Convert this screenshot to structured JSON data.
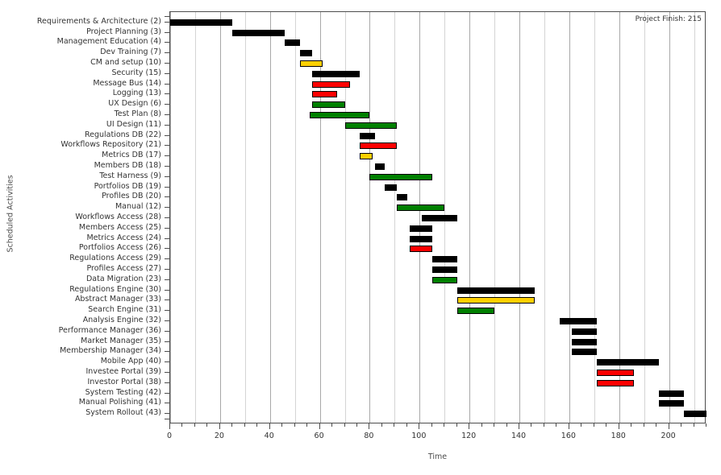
{
  "chart_data": {
    "type": "bar",
    "subtype": "gantt",
    "title": "",
    "xlabel": "Time",
    "ylabel": "Scheduled Activities",
    "xlim": [
      0,
      215
    ],
    "ylim": [
      0,
      43
    ],
    "grid": true,
    "grid_minor_step": 10,
    "grid_major_step": 20,
    "xticks_major": [
      0,
      20,
      40,
      60,
      80,
      100,
      120,
      140,
      160,
      180,
      200
    ],
    "xticks_minor_step": 5,
    "xtick_labels": [
      "0",
      "20",
      "40",
      "60",
      "80",
      "100",
      "120",
      "140",
      "160",
      "180",
      "200"
    ],
    "legend": null,
    "annotations": [
      {
        "name": "project-finish",
        "text": "Project Finish: 215",
        "position": "top-right"
      }
    ],
    "colors": {
      "black": "#000000",
      "red": "#ff0000",
      "green": "#008000",
      "gold": "#ffd000",
      "border": "#000000",
      "gridline_minor": "#d4d4d4",
      "gridline_major": "#a8a8a8",
      "axis": "#4d4d4d",
      "background": "#ffffff"
    },
    "categories": [
      "Requirements & Architecture (2)",
      "Project Planning (3)",
      "Management Education (4)",
      "Dev Training (7)",
      "CM and setup (10)",
      "Security (15)",
      "Message Bus (14)",
      "Logging (13)",
      "UX Design (6)",
      "Test Plan (8)",
      "UI Design (11)",
      "Regulations DB (22)",
      "Workflows Repository (21)",
      "Metrics DB (17)",
      "Members DB (18)",
      "Test Harness (9)",
      "Portfolios DB (19)",
      "Profiles DB (20)",
      "Manual (12)",
      "Workflows Access (28)",
      "Members Access (25)",
      "Metrics Access (24)",
      "Portfolios Access (26)",
      "Regulations Access (29)",
      "Profiles Access (27)",
      "Data Migration (23)",
      "Regulations Engine (30)",
      "Abstract Manager (33)",
      "Search Engine (31)",
      "Analysis Engine (32)",
      "Performance Manager (36)",
      "Market Manager (35)",
      "Membership Manager (34)",
      "Mobile App (40)",
      "Investee Portal (39)",
      "Investor Portal (38)",
      "System Testing (42)",
      "Manual Polishing (41)",
      "System Rollout (43)"
    ],
    "tasks": [
      {
        "label": "Requirements & Architecture (2)",
        "id": 2,
        "start": 0,
        "end": 25,
        "duration": 25,
        "color": "black"
      },
      {
        "label": "Project Planning (3)",
        "id": 3,
        "start": 25,
        "end": 46,
        "duration": 21,
        "color": "black"
      },
      {
        "label": "Management Education (4)",
        "id": 4,
        "start": 46,
        "end": 52,
        "duration": 6,
        "color": "black"
      },
      {
        "label": "Dev Training (7)",
        "id": 7,
        "start": 52,
        "end": 57,
        "duration": 5,
        "color": "black"
      },
      {
        "label": "CM and setup (10)",
        "id": 10,
        "start": 52,
        "end": 61,
        "duration": 9,
        "color": "gold"
      },
      {
        "label": "Security (15)",
        "id": 15,
        "start": 57,
        "end": 76,
        "duration": 19,
        "color": "black"
      },
      {
        "label": "Message Bus (14)",
        "id": 14,
        "start": 57,
        "end": 72,
        "duration": 15,
        "color": "red"
      },
      {
        "label": "Logging (13)",
        "id": 13,
        "start": 57,
        "end": 67,
        "duration": 10,
        "color": "red"
      },
      {
        "label": "UX Design (6)",
        "id": 6,
        "start": 57,
        "end": 70,
        "duration": 13,
        "color": "green"
      },
      {
        "label": "Test Plan (8)",
        "id": 8,
        "start": 56,
        "end": 80,
        "duration": 24,
        "color": "green"
      },
      {
        "label": "UI Design (11)",
        "id": 11,
        "start": 70,
        "end": 91,
        "duration": 21,
        "color": "green"
      },
      {
        "label": "Regulations DB (22)",
        "id": 22,
        "start": 76,
        "end": 82,
        "duration": 6,
        "color": "black"
      },
      {
        "label": "Workflows Repository (21)",
        "id": 21,
        "start": 76,
        "end": 91,
        "duration": 15,
        "color": "red"
      },
      {
        "label": "Metrics DB (17)",
        "id": 17,
        "start": 76,
        "end": 81,
        "duration": 5,
        "color": "gold"
      },
      {
        "label": "Members DB (18)",
        "id": 18,
        "start": 82,
        "end": 86,
        "duration": 4,
        "color": "black"
      },
      {
        "label": "Test Harness (9)",
        "id": 9,
        "start": 80,
        "end": 105,
        "duration": 25,
        "color": "green"
      },
      {
        "label": "Portfolios DB (19)",
        "id": 19,
        "start": 86,
        "end": 91,
        "duration": 5,
        "color": "black"
      },
      {
        "label": "Profiles DB (20)",
        "id": 20,
        "start": 91,
        "end": 95,
        "duration": 4,
        "color": "black"
      },
      {
        "label": "Manual (12)",
        "id": 12,
        "start": 91,
        "end": 110,
        "duration": 19,
        "color": "green"
      },
      {
        "label": "Workflows Access (28)",
        "id": 28,
        "start": 101,
        "end": 115,
        "duration": 14,
        "color": "black"
      },
      {
        "label": "Members Access (25)",
        "id": 25,
        "start": 96,
        "end": 105,
        "duration": 9,
        "color": "black"
      },
      {
        "label": "Metrics Access (24)",
        "id": 24,
        "start": 96,
        "end": 105,
        "duration": 9,
        "color": "black"
      },
      {
        "label": "Portfolios Access (26)",
        "id": 26,
        "start": 96,
        "end": 105,
        "duration": 9,
        "color": "red"
      },
      {
        "label": "Regulations Access (29)",
        "id": 29,
        "start": 105,
        "end": 115,
        "duration": 10,
        "color": "black"
      },
      {
        "label": "Profiles Access (27)",
        "id": 27,
        "start": 105,
        "end": 115,
        "duration": 10,
        "color": "black"
      },
      {
        "label": "Data Migration (23)",
        "id": 23,
        "start": 105,
        "end": 115,
        "duration": 10,
        "color": "green"
      },
      {
        "label": "Regulations Engine (30)",
        "id": 30,
        "start": 115,
        "end": 146,
        "duration": 31,
        "color": "black"
      },
      {
        "label": "Abstract Manager (33)",
        "id": 33,
        "start": 115,
        "end": 146,
        "duration": 31,
        "color": "gold"
      },
      {
        "label": "Search Engine (31)",
        "id": 31,
        "start": 115,
        "end": 130,
        "duration": 15,
        "color": "green"
      },
      {
        "label": "Analysis Engine (32)",
        "id": 32,
        "start": 156,
        "end": 171,
        "duration": 15,
        "color": "black"
      },
      {
        "label": "Performance Manager (36)",
        "id": 36,
        "start": 161,
        "end": 171,
        "duration": 10,
        "color": "black"
      },
      {
        "label": "Market Manager (35)",
        "id": 35,
        "start": 161,
        "end": 171,
        "duration": 10,
        "color": "black"
      },
      {
        "label": "Membership Manager (34)",
        "id": 34,
        "start": 161,
        "end": 171,
        "duration": 10,
        "color": "black"
      },
      {
        "label": "Mobile App (40)",
        "id": 40,
        "start": 171,
        "end": 196,
        "duration": 25,
        "color": "black"
      },
      {
        "label": "Investee Portal (39)",
        "id": 39,
        "start": 171,
        "end": 186,
        "duration": 15,
        "color": "red"
      },
      {
        "label": "Investor Portal (38)",
        "id": 38,
        "start": 171,
        "end": 186,
        "duration": 15,
        "color": "red"
      },
      {
        "label": "System Testing (42)",
        "id": 42,
        "start": 196,
        "end": 206,
        "duration": 10,
        "color": "black"
      },
      {
        "label": "Manual Polishing (41)",
        "id": 41,
        "start": 196,
        "end": 206,
        "duration": 10,
        "color": "black"
      },
      {
        "label": "System Rollout (43)",
        "id": 43,
        "start": 206,
        "end": 215,
        "duration": 9,
        "color": "black"
      }
    ]
  }
}
